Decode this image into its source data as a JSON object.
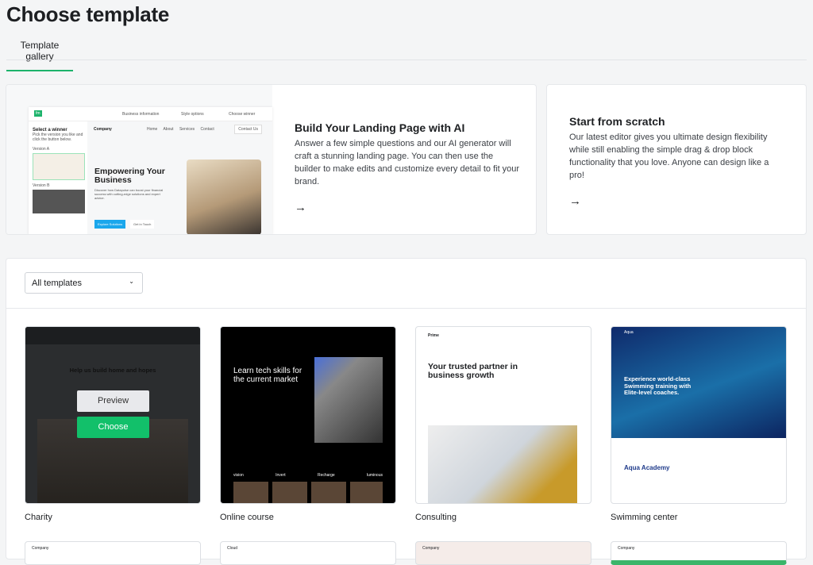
{
  "page_title": "Choose template",
  "tabs": [
    {
      "label": "Template gallery",
      "active": true
    }
  ],
  "ai_card": {
    "title": "Build Your Landing Page with AI",
    "description": "Answer a few simple questions and our AI generator will craft a stunning landing page. You can then use the builder to make edits and customize every detail to fit your brand.",
    "arrow_icon": "arrow-right-icon",
    "preview": {
      "steps": [
        "Business information",
        "Style options",
        "Choose winner"
      ],
      "sidebar_title": "Select a winner",
      "sidebar_text": "Pick the version you like and click the button below.",
      "version_a": "Version A",
      "version_b": "Version B",
      "brand": "Company",
      "nav": [
        "Home",
        "About",
        "Services",
        "Contact"
      ],
      "contact_btn": "Contact Us",
      "headline": "Empowering Your Business",
      "body": "Discover how Datapulse can boost your financial success with cutting-edge solutions and expert advice.",
      "btn_primary": "Explore Solutions",
      "btn_secondary": "Get in Touch"
    }
  },
  "scratch_card": {
    "title": "Start from scratch",
    "description": "Our latest editor gives you ultimate design flexibility while still enabling the simple drag & drop block functionality that you love. Anyone can design like a pro!",
    "arrow_icon": "arrow-right-icon"
  },
  "filter": {
    "selected": "All templates"
  },
  "templates": [
    {
      "name": "Charity",
      "headline": "Help us build home and hopes",
      "hover": true,
      "preview_label": "Preview",
      "choose_label": "Choose"
    },
    {
      "name": "Online course",
      "headline": "Learn tech skills for the current market",
      "logos": [
        "vision",
        "Invert",
        "Recharge",
        "luminous"
      ]
    },
    {
      "name": "Consulting",
      "brand": "Prime",
      "headline": "Your trusted partner in business growth"
    },
    {
      "name": "Swimming center",
      "brand": "Aqua",
      "headline": "Experience world-class Swimming training with Elite-level coaches.",
      "subheading": "Aqua Academy"
    }
  ],
  "next_row": [
    {
      "brand": "Company"
    },
    {
      "brand": "Cloud"
    },
    {
      "brand": "Company"
    },
    {
      "brand": "Company"
    }
  ],
  "colors": {
    "accent": "#1db36b",
    "choose": "#12c06a"
  }
}
